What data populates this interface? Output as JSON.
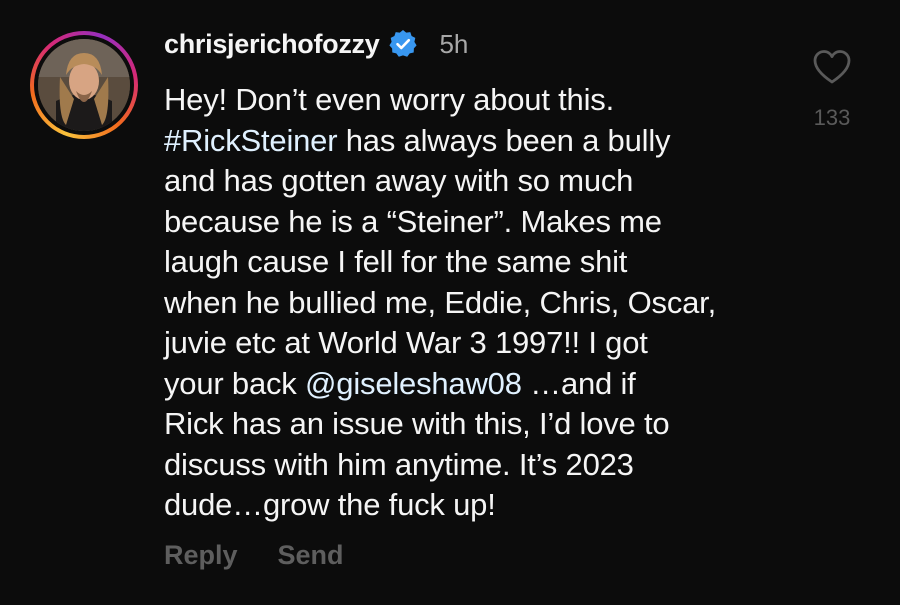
{
  "comment": {
    "username": "chrisjerichofozzy",
    "verified_icon": "verified-badge-icon",
    "timestamp": "5h",
    "lines": [
      [
        {
          "t": "Hey! Don’t even worry about this.",
          "k": "text"
        }
      ],
      [
        {
          "t": "#RickSteiner",
          "k": "hashtag"
        },
        {
          "t": " has always been a bully",
          "k": "text"
        }
      ],
      [
        {
          "t": "and has gotten away with so much",
          "k": "text"
        }
      ],
      [
        {
          "t": "because he is a “Steiner”. Makes me",
          "k": "text"
        }
      ],
      [
        {
          "t": "laugh cause I fell for the same shit",
          "k": "text"
        }
      ],
      [
        {
          "t": "when he bullied me, Eddie, Chris, Oscar,",
          "k": "text"
        }
      ],
      [
        {
          "t": "juvie etc at World War 3 1997!! I got",
          "k": "text"
        }
      ],
      [
        {
          "t": "your back ",
          "k": "text"
        },
        {
          "t": "@giseleshaw08",
          "k": "mention"
        },
        {
          "t": " …and if",
          "k": "text"
        }
      ],
      [
        {
          "t": "Rick has an issue with this, I’d love to",
          "k": "text"
        }
      ],
      [
        {
          "t": "discuss with him anytime.  It’s 2023",
          "k": "text"
        }
      ],
      [
        {
          "t": "dude…grow the fuck up!",
          "k": "text"
        }
      ]
    ],
    "actions": {
      "reply_label": "Reply",
      "send_label": "Send"
    },
    "like": {
      "icon": "heart-outline-icon",
      "count": "133"
    }
  },
  "colors": {
    "background": "#0c0c0c",
    "text": "#f5f5f5",
    "muted": "#a8a8a8",
    "verified": "#3897f0",
    "hashtag": "#e0f1ff"
  }
}
